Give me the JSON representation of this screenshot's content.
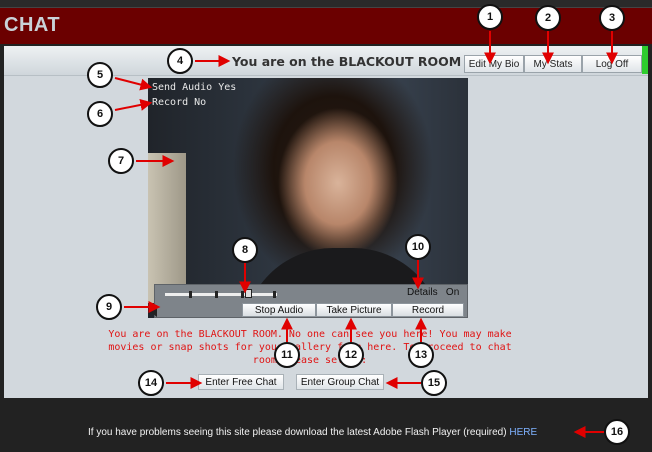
{
  "app": {
    "title": "CHAT"
  },
  "room": {
    "title": "You are on the BLACKOUT ROOM"
  },
  "toolbar": {
    "edit_bio": "Edit My Bio",
    "my_stats": "My Stats",
    "log_off": "Log Off"
  },
  "video": {
    "send_audio": "Send Audio Yes",
    "record_status": "Record No",
    "details_label": "Details",
    "details_state": "On"
  },
  "controls": {
    "stop_audio": "Stop Audio",
    "take_picture": "Take Picture",
    "record": "Record"
  },
  "message": "You are on the BLACKOUT ROOM. No one can see you here! You may make movies or snap shots for your gallery from here. To proceed to chat room please select:",
  "chat_buttons": {
    "free_chat": "Enter Free Chat",
    "group_chat": "Enter Group Chat"
  },
  "footer": {
    "text": "If you have problems seeing this site please download the latest Adobe Flash Player (required) ",
    "link": "HERE"
  },
  "callouts": [
    "1",
    "2",
    "3",
    "4",
    "5",
    "6",
    "7",
    "8",
    "9",
    "10",
    "11",
    "12",
    "13",
    "14",
    "15",
    "16"
  ],
  "colors": {
    "titlebar": "#6b0000",
    "callout_arrow": "#e00000",
    "message_text": "#e01414",
    "link": "#7fb2ff"
  }
}
